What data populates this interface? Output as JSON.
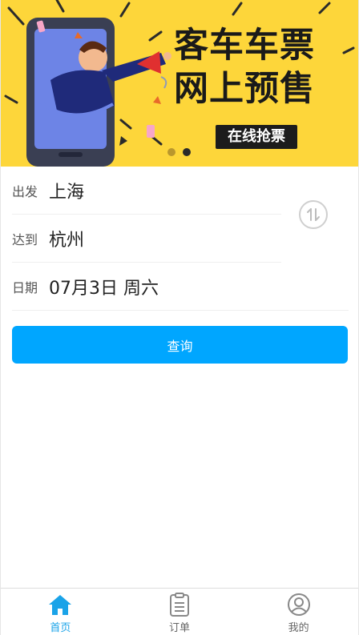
{
  "banner": {
    "title_line1": "客车车票",
    "title_line2": "网上预售",
    "tag": "在线抢票",
    "background_color": "#fdd63a",
    "slides_count": 2,
    "active_slide": 2
  },
  "form": {
    "depart_label": "出发",
    "depart_value": "上海",
    "arrive_label": "达到",
    "arrive_value": "杭州",
    "date_label": "日期",
    "date_value": "07月3日 周六",
    "swap_icon": "swap-arrows-icon"
  },
  "actions": {
    "query_label": "查询",
    "query_color": "#00a6ff"
  },
  "tabbar": {
    "tabs": [
      {
        "label": "首页",
        "icon": "home-icon",
        "active": true
      },
      {
        "label": "订单",
        "icon": "clipboard-icon",
        "active": false
      },
      {
        "label": "我的",
        "icon": "user-icon",
        "active": false
      }
    ],
    "active_color": "#1aa3e8"
  }
}
